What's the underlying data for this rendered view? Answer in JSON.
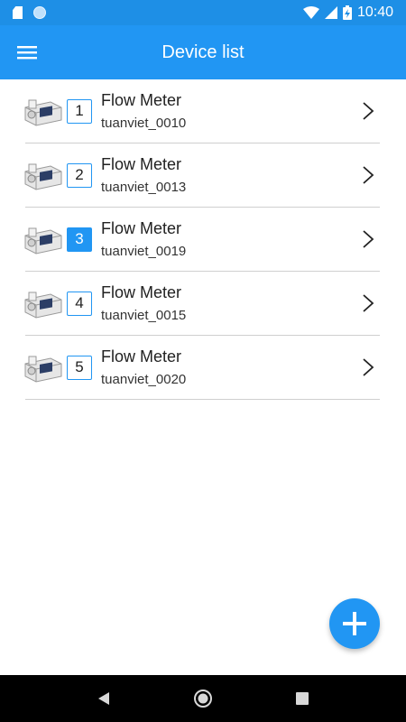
{
  "status_bar": {
    "time": "10:40",
    "icons": [
      "sd-card-icon",
      "notification-dot-icon",
      "wifi-icon",
      "signal-icon",
      "battery-charging-icon"
    ]
  },
  "app_bar": {
    "title": "Device list",
    "menu_icon": "hamburger-menu-icon"
  },
  "devices": [
    {
      "number": "1",
      "title": "Flow Meter",
      "subtitle": "tuanviet_0010",
      "selected": false
    },
    {
      "number": "2",
      "title": "Flow Meter",
      "subtitle": "tuanviet_0013",
      "selected": false
    },
    {
      "number": "3",
      "title": "Flow Meter",
      "subtitle": "tuanviet_0019",
      "selected": true
    },
    {
      "number": "4",
      "title": "Flow Meter",
      "subtitle": "tuanviet_0015",
      "selected": false
    },
    {
      "number": "5",
      "title": "Flow Meter",
      "subtitle": "tuanviet_0020",
      "selected": false
    }
  ],
  "fab": {
    "icon": "plus-icon"
  },
  "nav_bar": {
    "icons": [
      "back-icon",
      "home-icon",
      "recents-icon"
    ]
  },
  "colors": {
    "primary": "#2196f3",
    "status_bar": "#1e8fe6",
    "divider": "#cfcfcf"
  }
}
